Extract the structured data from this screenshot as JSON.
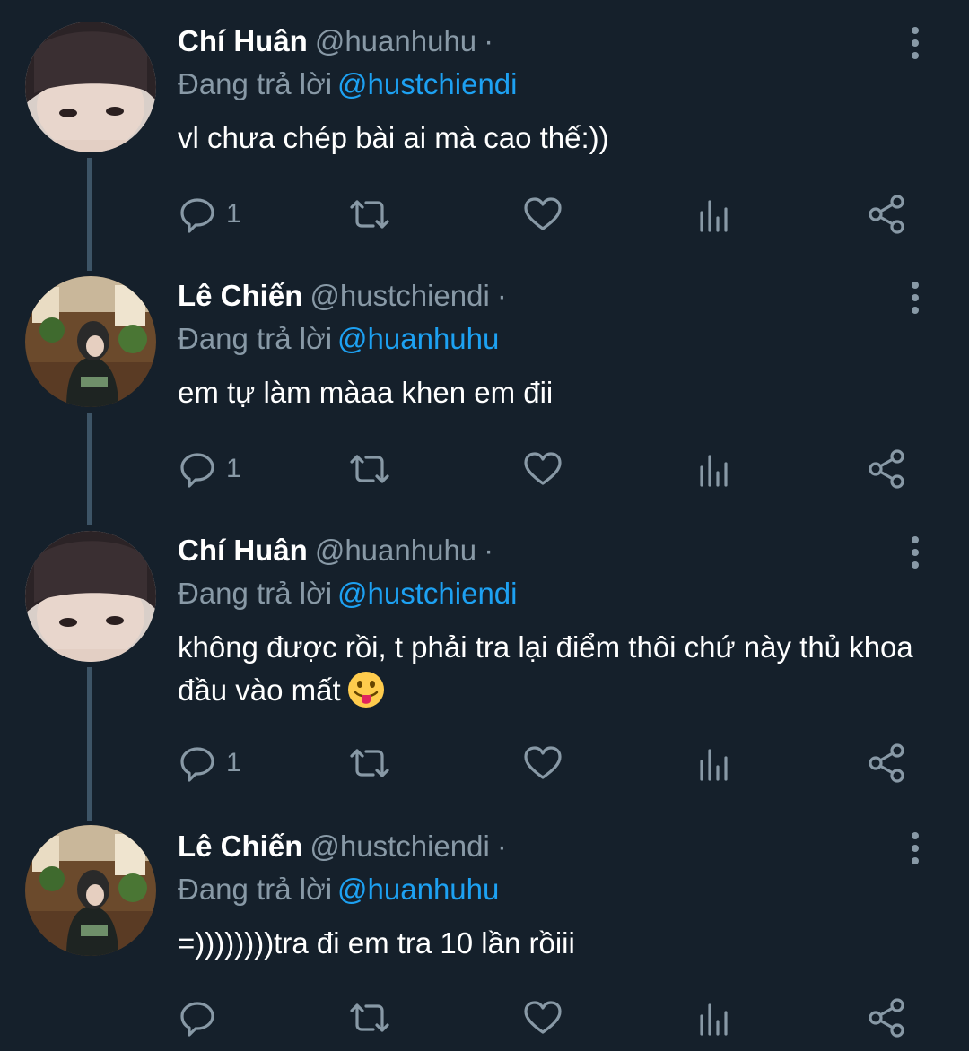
{
  "tweets": [
    {
      "name": "Chí Huân",
      "handle": "@huanhuhu",
      "dot": "·",
      "replying_prefix": "Đang trả lời",
      "replying_to": "@hustchiendi",
      "text": "vl chưa chép bài ai mà cao thế:))",
      "reply_count": "1",
      "avatar": "boy-face-avatar"
    },
    {
      "name": "Lê Chiến",
      "handle": "@hustchiendi",
      "dot": "·",
      "replying_prefix": "Đang trả lời",
      "replying_to": "@huanhuhu",
      "text": "em tự làm màaa khen em đii",
      "reply_count": "1",
      "avatar": "hoodie-cafe-avatar"
    },
    {
      "name": "Chí Huân",
      "handle": "@huanhuhu",
      "dot": "·",
      "replying_prefix": "Đang trả lời",
      "replying_to": "@hustchiendi",
      "text": "không được rồi, t phải tra lại điểm thôi chứ này thủ khoa đầu vào mất",
      "emoji": "tongue-out-emoji",
      "reply_count": "1",
      "avatar": "boy-face-avatar"
    },
    {
      "name": "Lê Chiến",
      "handle": "@hustchiendi",
      "dot": "·",
      "replying_prefix": "Đang trả lời",
      "replying_to": "@huanhuhu",
      "text": "=))))))))tra đi em tra 10 lần rồiii",
      "reply_count": "",
      "avatar": "hoodie-cafe-avatar"
    }
  ],
  "icons": [
    "reply-icon",
    "retweet-icon",
    "like-icon",
    "analytics-icon",
    "share-icon",
    "more-options-icon"
  ],
  "colors": {
    "background": "#15202b",
    "text": "#ffffff",
    "secondary": "#8899a6",
    "link": "#1da1f2",
    "thread_line": "#3d5466"
  }
}
